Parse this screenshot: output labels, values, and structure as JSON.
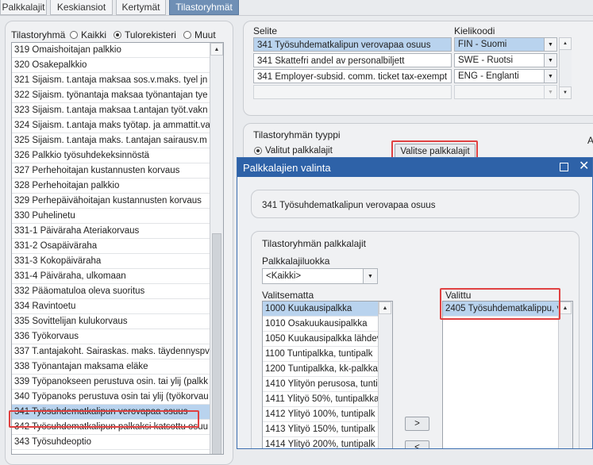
{
  "tabs": [
    {
      "label": "Palkkalajit"
    },
    {
      "label": "Keskiansiot"
    },
    {
      "label": "Kertymät"
    },
    {
      "label": "Tilastoryhmät"
    }
  ],
  "left": {
    "label": "Tilastoryhmä",
    "radios": [
      {
        "label": "Kaikki",
        "checked": false
      },
      {
        "label": "Tulorekisteri",
        "checked": true
      },
      {
        "label": "Muut",
        "checked": false
      }
    ],
    "items": [
      "319 Omaishoitajan palkkio",
      "320 Osakepalkkio",
      "321 Sijaism. t.antaja maksaa sos.v.maks. tyel jn",
      "322 Sijaism. työnantaja maksaa työnantajan tye",
      "323 Sijaism. t.antaja maksaa t.antajan työt.vakn",
      "324 Sijaism. t.antaja maks työtap. ja ammattit.va",
      "325 Sijaism. t.antaja maks. t.antajan sairausv.m",
      "326 Palkkio työsuhdekeksinnöstä",
      "327 Perhehoitajan kustannusten korvaus",
      "328 Perhehoitajan palkkio",
      "329 Perhepäivähoitajan kustannusten korvaus",
      "330 Puhelinetu",
      "331-1 Päiväraha Ateriakorvaus",
      "331-2 Osapäiväraha",
      "331-3 Kokopäiväraha",
      "331-4 Päiväraha, ulkomaan",
      "332 Pääomatuloa oleva suoritus",
      "334 Ravintoetu",
      "335 Sovittelijan kulukorvaus",
      "336 Työkorvaus",
      "337 T.antajakoht. Sairaskas. maks. täydennyspv",
      "338 Työnantajan maksama eläke",
      "339 Työpanokseen perustuva osin. tai ylij (palkk",
      "340 Työpanoks perustuva osin tai ylij (työkorvau",
      "341 Työsuhdematkalipun verovapaa osuus",
      "342 Työsuhdematkalipun palkaksi katsottu osuu",
      "343 Työsuhdeoptio"
    ],
    "selected_index": 24
  },
  "selite": {
    "header_selite": "Selite",
    "header_kielikoodi": "Kielikoodi",
    "rows": [
      {
        "text": "341 Työsuhdematkalipun verovapaa osuus",
        "lang": "FIN - Suomi"
      },
      {
        "text": "341 Skattefri andel av personalbiljett",
        "lang": "SWE - Ruotsi"
      },
      {
        "text": "341 Employer-subsid. comm. ticket tax-exempt",
        "lang": "ENG - Englanti"
      },
      {
        "text": "",
        "lang": ""
      }
    ]
  },
  "tyyppi": {
    "title": "Tilastoryhmän tyyppi",
    "radio_label": "Valitut palkkalajit",
    "button": "Valitse palkkalajit",
    "right_letter": "A"
  },
  "dialog": {
    "title": "Palkkalajien valinta",
    "header_text": "341 Työsuhdematkalipun verovapaa osuus",
    "group_title": "Tilastoryhmän palkkalajit",
    "class_label": "Palkkalajiluokka",
    "class_value": "<Kaikki>",
    "unselected_label": "Valitsematta",
    "unselected": [
      "1000 Kuukausipalkka",
      "1010 Osakuukausipalkka",
      "1050 Kuukausipalkka lähdev",
      "1100 Tuntipalkka, tuntipalk",
      "1200 Tuntipalkka, kk-palkkai",
      "1410 Ylityön perusosa, tunti",
      "1411 Ylityö 50%, tuntipalkka",
      "1412 Ylityö 100%, tuntipalk",
      "1413 Ylityö 150%, tuntipalk",
      "1414 Ylityö 200%, tuntipalk"
    ],
    "selected_label": "Valittu",
    "selected": [
      "2405 Työsuhdematkalippu, v"
    ],
    "btn_add": ">",
    "btn_remove": "<"
  }
}
